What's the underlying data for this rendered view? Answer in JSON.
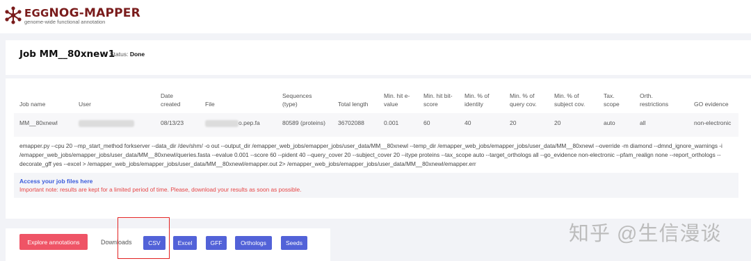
{
  "header": {
    "title_prefix": "EGG",
    "title_main": "NOG-MAPPER",
    "subtitle": "genome-wide functional annotation",
    "logo_icon": "network-nodes-icon",
    "logo_color": "#7a1c1c"
  },
  "job": {
    "title": "Job MM__80xnew1",
    "status_label": "Status:",
    "status_value": "Done"
  },
  "table": {
    "headers": [
      "Job name",
      "User",
      "Date created",
      "File",
      "Sequences (type)",
      "Total length",
      "Min. hit e-value",
      "Min. hit bit-score",
      "Min. % of identity",
      "Min. % of query cov.",
      "Min. % of subject cov.",
      "Tax. scope",
      "Orth. restrictions",
      "GO evidence"
    ],
    "row": [
      "MM__80xnewl",
      "",
      "08/13/23",
      "o.pep.fa",
      "80589 (proteins)",
      "36702088",
      "0.001",
      "60",
      "40",
      "20",
      "20",
      "auto",
      "all",
      "non-electronic"
    ]
  },
  "command": "emapper.py --cpu 20 --mp_start_method forkserver --data_dir /dev/shm/ -o out --output_dir /emapper_web_jobs/emapper_jobs/user_data/MM__80xnewl --temp_dir /emapper_web_jobs/emapper_jobs/user_data/MM__80xnewl --override -m diamond --dmnd_ignore_warnings -i /emapper_web_jobs/emapper_jobs/user_data/MM__80xnewl/queries.fasta --evalue 0.001 --score 60 --pident 40 --query_cover 20 --subject_cover 20 --itype proteins --tax_scope auto --target_orthologs all --go_evidence non-electronic --pfam_realign none --report_orthologs --decorate_gff yes --excel > /emapper_web_jobs/emapper_jobs/user_data/MM__80xnewl/emapper.out 2> /emapper_web_jobs/emapper_jobs/user_data/MM__80xnewl/emapper.err",
  "access": {
    "link_text": "Access your job files here",
    "note": "Important note: results are kept for a limited period of time. Please, download your results as soon as possible."
  },
  "actions": {
    "explore_label": "Explore annotations",
    "downloads_label": "Downloads",
    "csv_label": "CSV",
    "excel_label": "Excel",
    "gff_label": "GFF",
    "orthologs_label": "Orthologs",
    "seeds_label": "Seeds"
  },
  "watermark": "知乎 @生信漫谈",
  "colors": {
    "explore_button": "#ef5466",
    "download_button": "#5262d8",
    "link": "#3b5bdb",
    "note": "#e64545",
    "highlight": "#e22020"
  }
}
